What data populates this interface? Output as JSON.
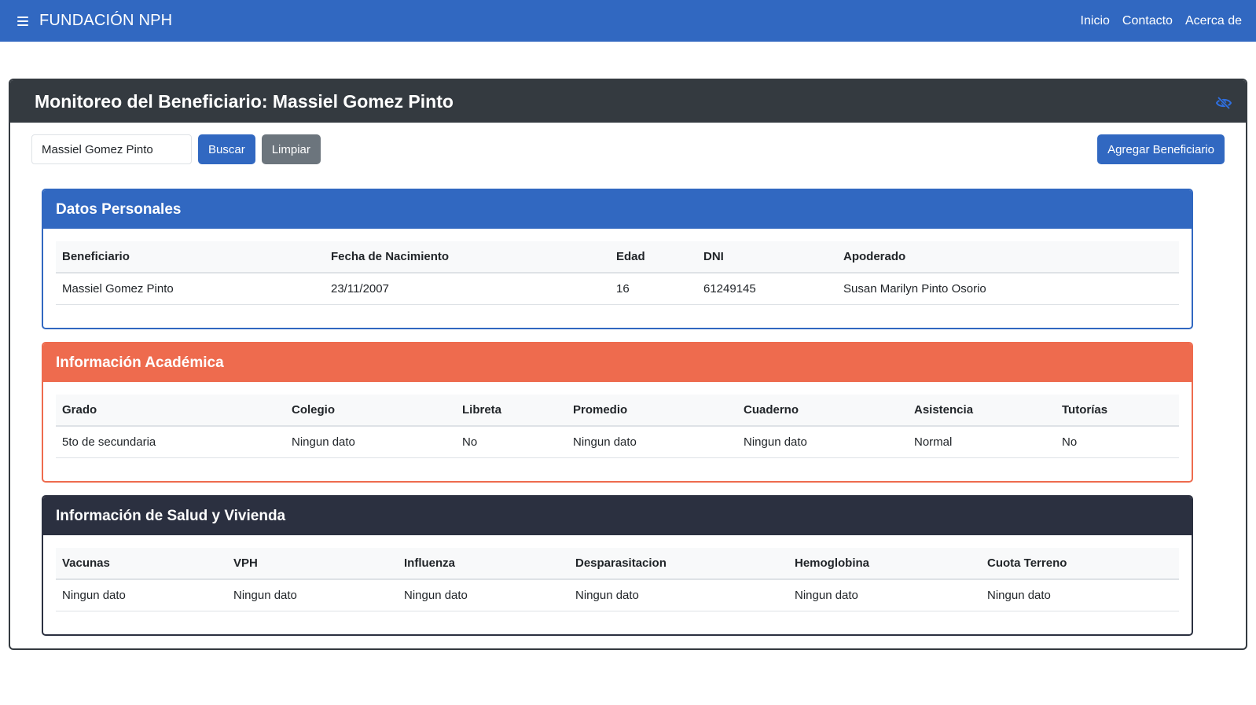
{
  "navbar": {
    "brand": "FUNDACIÓN NPH",
    "links": [
      "Inicio",
      "Contacto",
      "Acerca de"
    ]
  },
  "main": {
    "title": "Monitoreo del Beneficiario: Massiel Gomez Pinto",
    "toggle_icon": "eye-slash-icon",
    "search": {
      "value": "Massiel Gomez Pinto",
      "placeholder": ""
    },
    "buscar_label": "Buscar",
    "limpiar_label": "Limpiar",
    "agregar_label": "Agregar Beneficiario"
  },
  "datos_personales": {
    "title": "Datos Personales",
    "headers": [
      "Beneficiario",
      "Fecha de Nacimiento",
      "Edad",
      "DNI",
      "Apoderado"
    ],
    "row": [
      "Massiel Gomez Pinto",
      "23/11/2007",
      "16",
      "61249145",
      "Susan Marilyn Pinto Osorio"
    ]
  },
  "academica": {
    "title": "Información Académica",
    "headers": [
      "Grado",
      "Colegio",
      "Libreta",
      "Promedio",
      "Cuaderno",
      "Asistencia",
      "Tutorías"
    ],
    "row": [
      "5to de secundaria",
      "Ningun dato",
      "No",
      "Ningun dato",
      "Ningun dato",
      "Normal",
      "No"
    ]
  },
  "salud": {
    "title": "Información de Salud y Vivienda",
    "headers": [
      "Vacunas",
      "VPH",
      "Influenza",
      "Desparasitacion",
      "Hemoglobina",
      "Cuota Terreno"
    ],
    "row": [
      "Ningun dato",
      "Ningun dato",
      "Ningun dato",
      "Ningun dato",
      "Ningun dato",
      "Ningun dato"
    ]
  },
  "colors": {
    "primary": "#3168c1",
    "secondary": "#6c757d",
    "orange": "#ee6b4e",
    "dark": "#343a40",
    "navy": "#2b3040"
  }
}
